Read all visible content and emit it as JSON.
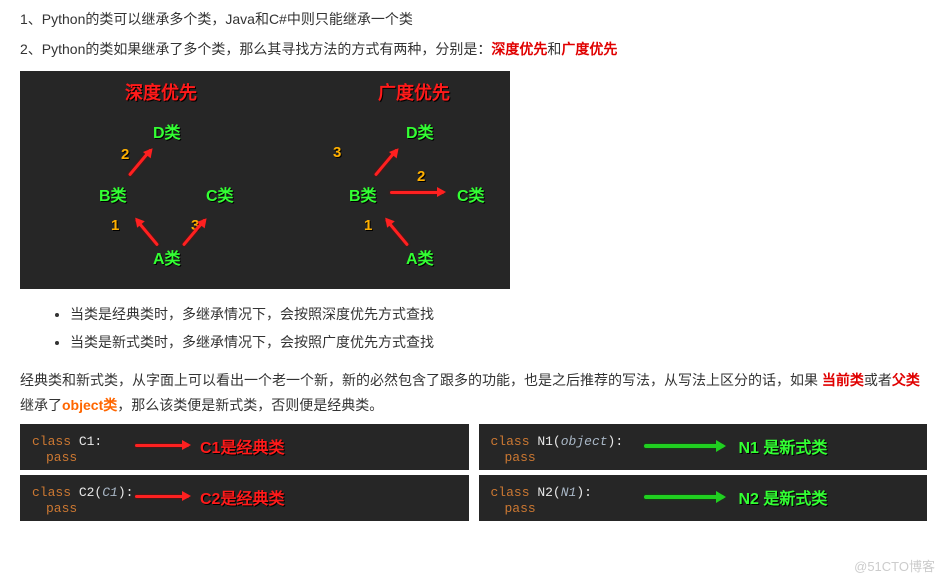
{
  "points": {
    "p1": "1、Python的类可以继承多个类，Java和C#中则只能继承一个类",
    "p2a": "2、Python的类如果继承了多个类，那么其寻找方法的方式有两种，分别是：",
    "p2b": "深度优先",
    "p2c": "和",
    "p2d": "广度优先"
  },
  "diagram": {
    "title1": "深度优先",
    "title2": "广度优先",
    "nodeA": "A类",
    "nodeB": "B类",
    "nodeC": "C类",
    "nodeD": "D类",
    "n1": "1",
    "n2": "2",
    "n3": "3"
  },
  "bullets": {
    "b1": "当类是经典类时，多继承情况下，会按照深度优先方式查找",
    "b2": "当类是新式类时，多继承情况下，会按照广度优先方式查找"
  },
  "explain": {
    "e1": "经典类和新式类，从字面上可以看出一个老一个新，新的必然包含了跟多的功能，也是之后推荐的写法，从写法上区分的话，如果 ",
    "e2": "当前类",
    "e3": "或者",
    "e4": "父类",
    "e5": "继承了",
    "e6": "object类",
    "e7": "，那么该类便是新式类，否则便是经典类。"
  },
  "code": {
    "kw_class": "class",
    "c1": " C1:",
    "c2a": " C2(",
    "c2b": "C1",
    "c2c": "):",
    "n1a": " N1(",
    "n1b": "object",
    "n1c": "):",
    "n2a": " N2(",
    "n2b": "N1",
    "n2c": "):",
    "pass": "pass",
    "a1": "C1是经典类",
    "a2": "C2是经典类",
    "a3": "N1 是新式类",
    "a4": "N2 是新式类"
  },
  "watermark": "@51CTO博客"
}
